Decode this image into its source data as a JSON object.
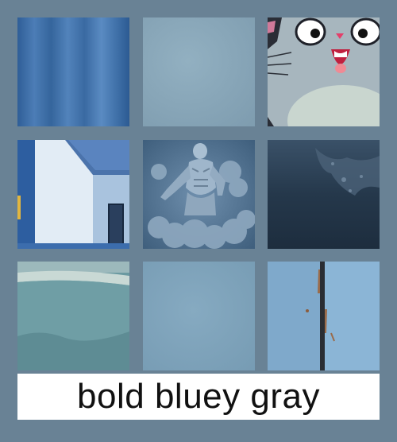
{
  "caption": "bold bluey gray",
  "colors": {
    "background": "#698295",
    "caption_bg": "#ffffff",
    "caption_text": "#111111"
  },
  "tiles": [
    {
      "name": "blue-curtain-image",
      "color": "#3f6fa6"
    },
    {
      "name": "plain-blue-gray-swatch",
      "color": "#8aa8b9"
    },
    {
      "name": "cartoon-cat-image",
      "color": "#a9b8c0"
    },
    {
      "name": "blue-white-house-image",
      "color": "#5d89c2"
    },
    {
      "name": "cloud-strongman-sculpture-image",
      "color": "#4c6f8c"
    },
    {
      "name": "dark-textured-wall-image",
      "color": "#27384b"
    },
    {
      "name": "teal-bowl-closeup-image",
      "color": "#6f9aa2"
    },
    {
      "name": "pale-blue-swatch",
      "color": "#7fa4bc"
    },
    {
      "name": "weathered-blue-wood-image",
      "color": "#86b2d3"
    }
  ]
}
